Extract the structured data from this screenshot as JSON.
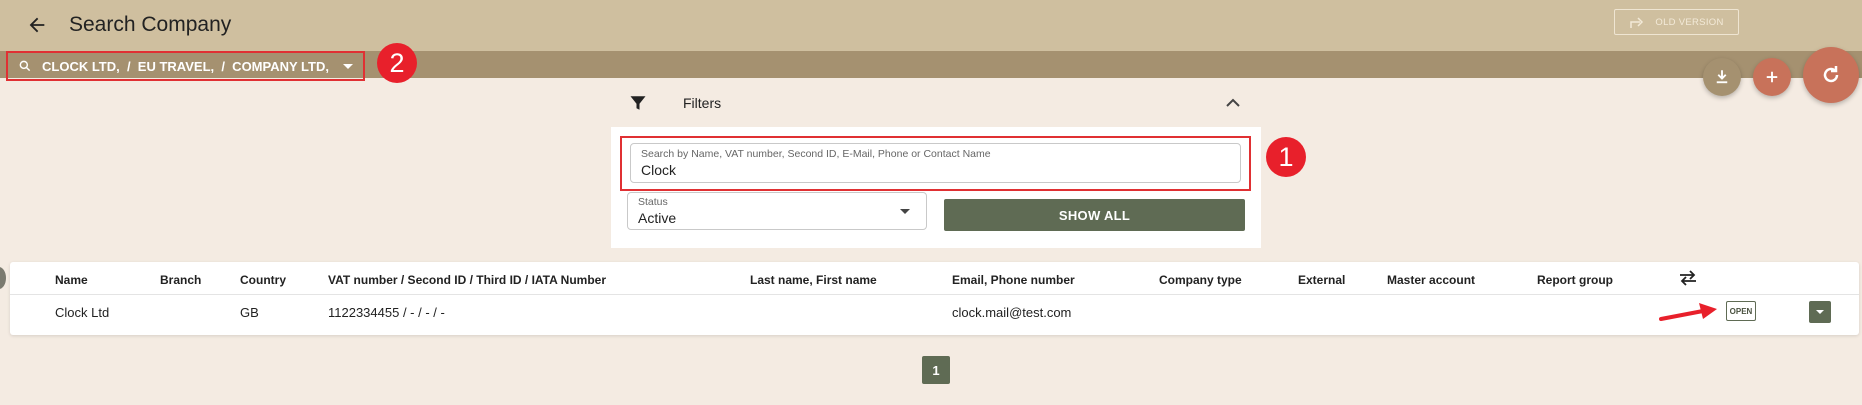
{
  "header": {
    "title": "Search Company",
    "old_version_label": "OLD VERSION"
  },
  "company_selector": {
    "text": "CLOCK LTD,  /  EU TRAVEL,  /  COMPANY LTD,"
  },
  "annotations": {
    "badge_1": "1",
    "badge_2": "2"
  },
  "filters": {
    "label": "Filters",
    "search": {
      "label": "Search by Name, VAT number, Second ID, E-Mail, Phone or Contact Name",
      "value": "Clock"
    },
    "status": {
      "label": "Status",
      "value": "Active"
    },
    "show_all_label": "SHOW ALL"
  },
  "table": {
    "columns": [
      "Name",
      "Branch",
      "Country",
      "VAT number / Second ID / Third ID / IATA Number",
      "Last name, First name",
      "Email, Phone number",
      "Company type",
      "External",
      "Master account",
      "Report group"
    ],
    "rows": [
      {
        "name": "Clock Ltd",
        "branch": "",
        "country": "GB",
        "vat": "1122334455 / - / - / -",
        "contact_name": "",
        "email_phone": "clock.mail@test.com",
        "company_type": "",
        "external": "",
        "master_account": "",
        "report_group": "",
        "open_label": "OPEN"
      }
    ]
  },
  "pagination": {
    "current_page": "1"
  },
  "colors": {
    "header_bg": "#cfbf9f",
    "subbar_bg": "#a59170",
    "page_bg": "#f4ebe2",
    "primary_button": "#5f6b54",
    "accent_fab": "#c8725a",
    "annotation_red": "#e8202b"
  }
}
